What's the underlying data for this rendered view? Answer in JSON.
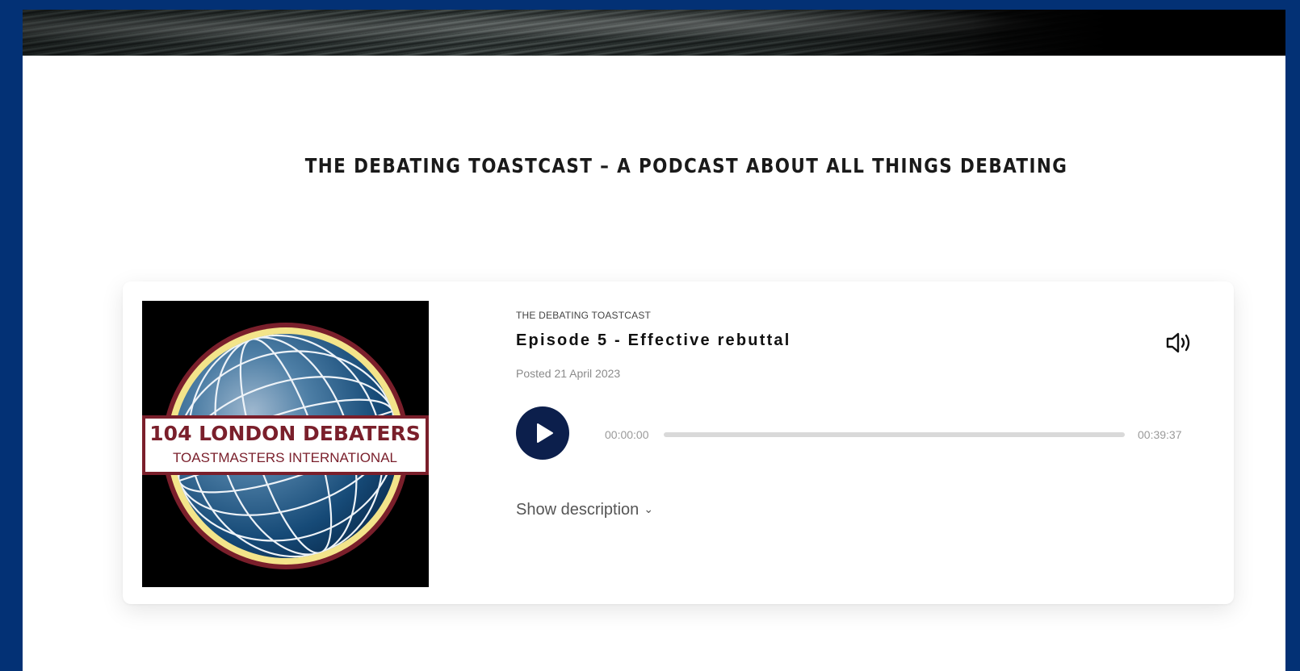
{
  "colors": {
    "frame_background": "#033175",
    "play_button": "#0c1f4c",
    "cover_logo_text": "#7a1f2b",
    "cover_globe": "#1c5582"
  },
  "page": {
    "heading": "THE DEBATING TOASTCAST – A PODCAST ABOUT ALL THINGS DEBATING"
  },
  "player": {
    "show_name": "THE DEBATING TOASTCAST",
    "episode_title": "Episode 5 - Effective rebuttal",
    "posted": "Posted 21 April 2023",
    "time_current": "00:00:00",
    "time_total": "00:39:37",
    "progress": 0.0,
    "show_description_label": "Show description",
    "volume_icon": "volume-icon",
    "play_icon": "play-icon",
    "chevron_icon": "chevron-down-icon"
  },
  "cover": {
    "title": "104 LONDON DEBATERS",
    "subtitle": "TOASTMASTERS INTERNATIONAL"
  }
}
